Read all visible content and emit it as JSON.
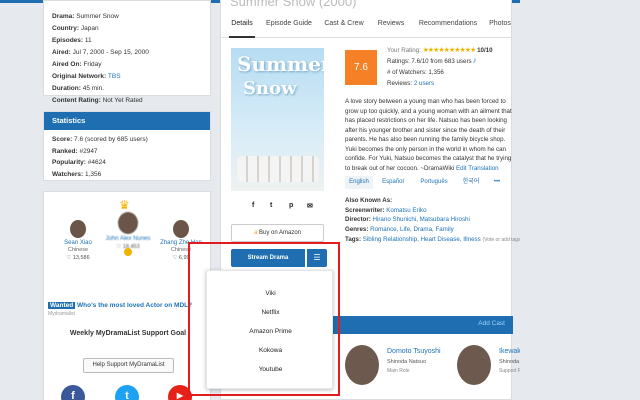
{
  "details": {
    "rows": [
      {
        "k": "Drama:",
        "v": "Summer Snow"
      },
      {
        "k": "Country:",
        "v": "Japan"
      },
      {
        "k": "Episodes:",
        "v": "11"
      },
      {
        "k": "Aired:",
        "v": "Jul 7, 2000 - Sep 15, 2000"
      },
      {
        "k": "Aired On:",
        "v": "Friday"
      },
      {
        "k": "Original Network:",
        "v": "TBS"
      },
      {
        "k": "Duration:",
        "v": "45 min."
      },
      {
        "k": "Content Rating:",
        "v": "Not Yet Rated"
      }
    ]
  },
  "statistics": {
    "title": "Statistics",
    "rows": [
      {
        "k": "Score:",
        "v": "7.6 (scored by 685 users)"
      },
      {
        "k": "Ranked:",
        "v": "#2947"
      },
      {
        "k": "Popularity:",
        "v": "#4624"
      },
      {
        "k": "Watchers:",
        "v": "1,356"
      }
    ]
  },
  "vote": {
    "actors": [
      {
        "name": "Sean Xiao",
        "nationality": "Chinese",
        "votes": "13,586"
      },
      {
        "name": "John Alex Nunes",
        "nationality": "Filipino",
        "votes": "18,453"
      },
      {
        "name": "Zhang Zhe Han",
        "nationality": "Chinese",
        "votes": "6,99"
      }
    ],
    "wanted": "Wanted",
    "question": "Who's the most loved Actor on MDL?",
    "sponsored": "Mydramalist",
    "goal": "Weekly MyDramaList Support Goal",
    "support_button": "Help Support MyDramaList",
    "social": [
      "f",
      "t",
      "▶"
    ]
  },
  "main": {
    "title": "Summer Snow (2000)",
    "tabs": [
      "Details",
      "Episode Guide",
      "Cast & Crew",
      "Reviews",
      "Recommendations",
      "Photos"
    ],
    "poster_title_line1": "Summer",
    "poster_title_line2": "Snow",
    "share_icons": [
      "f",
      "t",
      "p",
      "✉"
    ],
    "buy_button": "Buy on Amazon",
    "stream_button": "Stream Drama",
    "score": "7.6",
    "your_rating_label": "Your Rating:",
    "your_rating_value": "10/10",
    "ratings_line": "Ratings: 7.6/10 from 683 users",
    "watchers_line": "# of Watchers: 1,356",
    "reviews_label": "Reviews:",
    "reviews_value": "2 users",
    "synopsis": "A love story between a young man who has been forced to grow up too quickly, and a young woman with an ailment that has placed restrictions on her life. Natsuo has been looking after his younger brother and sister since the death of their parents. He has also been running the family bicycle shop. Yuki becomes the only person in the world in whom he can confide. For Yuki, Natsuo becomes the catalyst that he trying to break out of her cocoon. ~DramaWiki",
    "edit_translation": "Edit Translation",
    "languages": [
      "English",
      "Español",
      "Português",
      "한국어",
      "•••"
    ],
    "also_known_as": "Also Known As:",
    "screenwriter_label": "Screenwriter:",
    "screenwriter": "Komatsu Eriko",
    "director_label": "Director:",
    "director": "Hirano Shunichi, Matsubara Hiroshi",
    "genres_label": "Genres:",
    "genres": "Romance, Life, Drama, Family",
    "tags_label": "Tags:",
    "tags": "Sibling Relationship, Heart Disease, Illness",
    "tags_note": "(Vote or add tags)",
    "add_cast": "Add Cast",
    "cast": [
      {
        "name": "Domoto Tsuyoshi",
        "role": "Shinoda Natsuo",
        "type": "Main Role"
      },
      {
        "name": "Ikewaki Chizuru",
        "role": "Shinoda Chika",
        "type": "Support Role"
      }
    ]
  },
  "streaming_menu": [
    "Viki",
    "Netflix",
    "Amazon Prime",
    "Kokowa",
    "Youtube"
  ],
  "colors": {
    "brand": "#1e6eb1",
    "score": "#f58025",
    "highlight": "#e21c1c"
  }
}
